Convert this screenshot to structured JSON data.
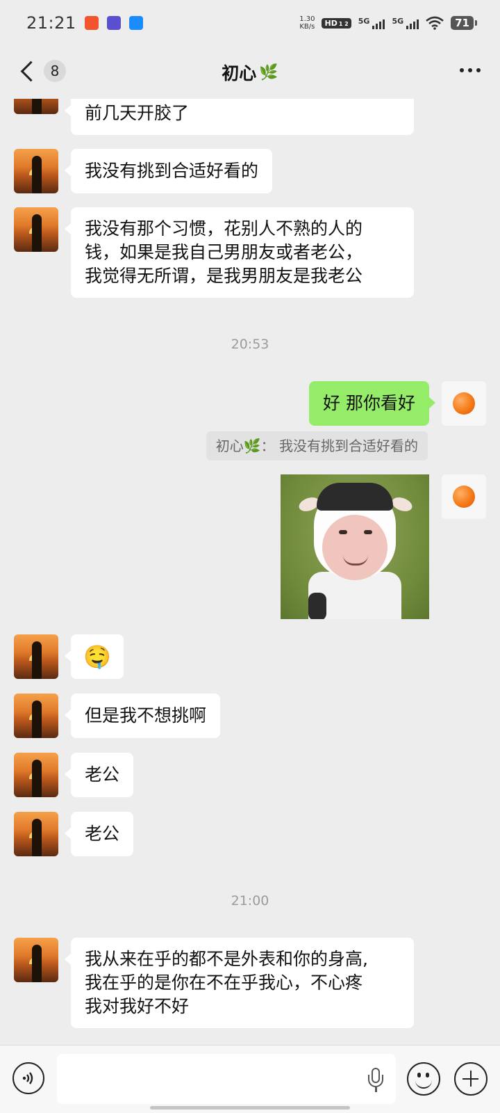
{
  "status_bar": {
    "time": "21:21",
    "net_speed_value": "1.30",
    "net_speed_unit": "KB/s",
    "hd_label": "HD",
    "hd_sub": "1 2",
    "sig1_label": "5G",
    "sig2_label": "5G",
    "battery": "71",
    "app_icon_colors": [
      "#f2542d",
      "#5a4fcf",
      "#1a8cff"
    ]
  },
  "header": {
    "unread_count": "8",
    "title": "初心",
    "title_emoji": "🌿"
  },
  "messages": [
    {
      "side": "left",
      "text": "前几天开胶了"
    },
    {
      "side": "left",
      "text": "我没有挑到合适好看的"
    },
    {
      "side": "left",
      "lines": [
        "我没有那个习惯，花别人不熟的人的",
        "钱，如果是我自己男朋友或者老公，",
        "我觉得无所谓，是我男朋友是我老公"
      ]
    },
    {
      "side": "time",
      "text": "20:53"
    },
    {
      "side": "right",
      "text": "好 那你看好"
    },
    {
      "side": "quote",
      "text": "初心🌿：  我没有挑到合适好看的"
    },
    {
      "side": "right",
      "type": "sticker"
    },
    {
      "side": "left",
      "type": "emoji",
      "text": "🤤"
    },
    {
      "side": "left",
      "text": "但是我不想挑啊"
    },
    {
      "side": "left",
      "text": "老公"
    },
    {
      "side": "left",
      "text": "老公"
    },
    {
      "side": "time",
      "text": "21:00"
    },
    {
      "side": "left",
      "lines": [
        "我从来在乎的都不是外表和你的身高,",
        "我在乎的是你在不在乎我心，不心疼",
        "我对我好不好"
      ]
    }
  ],
  "input_bar": {
    "placeholder": "",
    "voice_symbol": "◖))"
  },
  "colors": {
    "background": "#ededed",
    "bubble_left": "#ffffff",
    "bubble_right": "#95ec69"
  }
}
